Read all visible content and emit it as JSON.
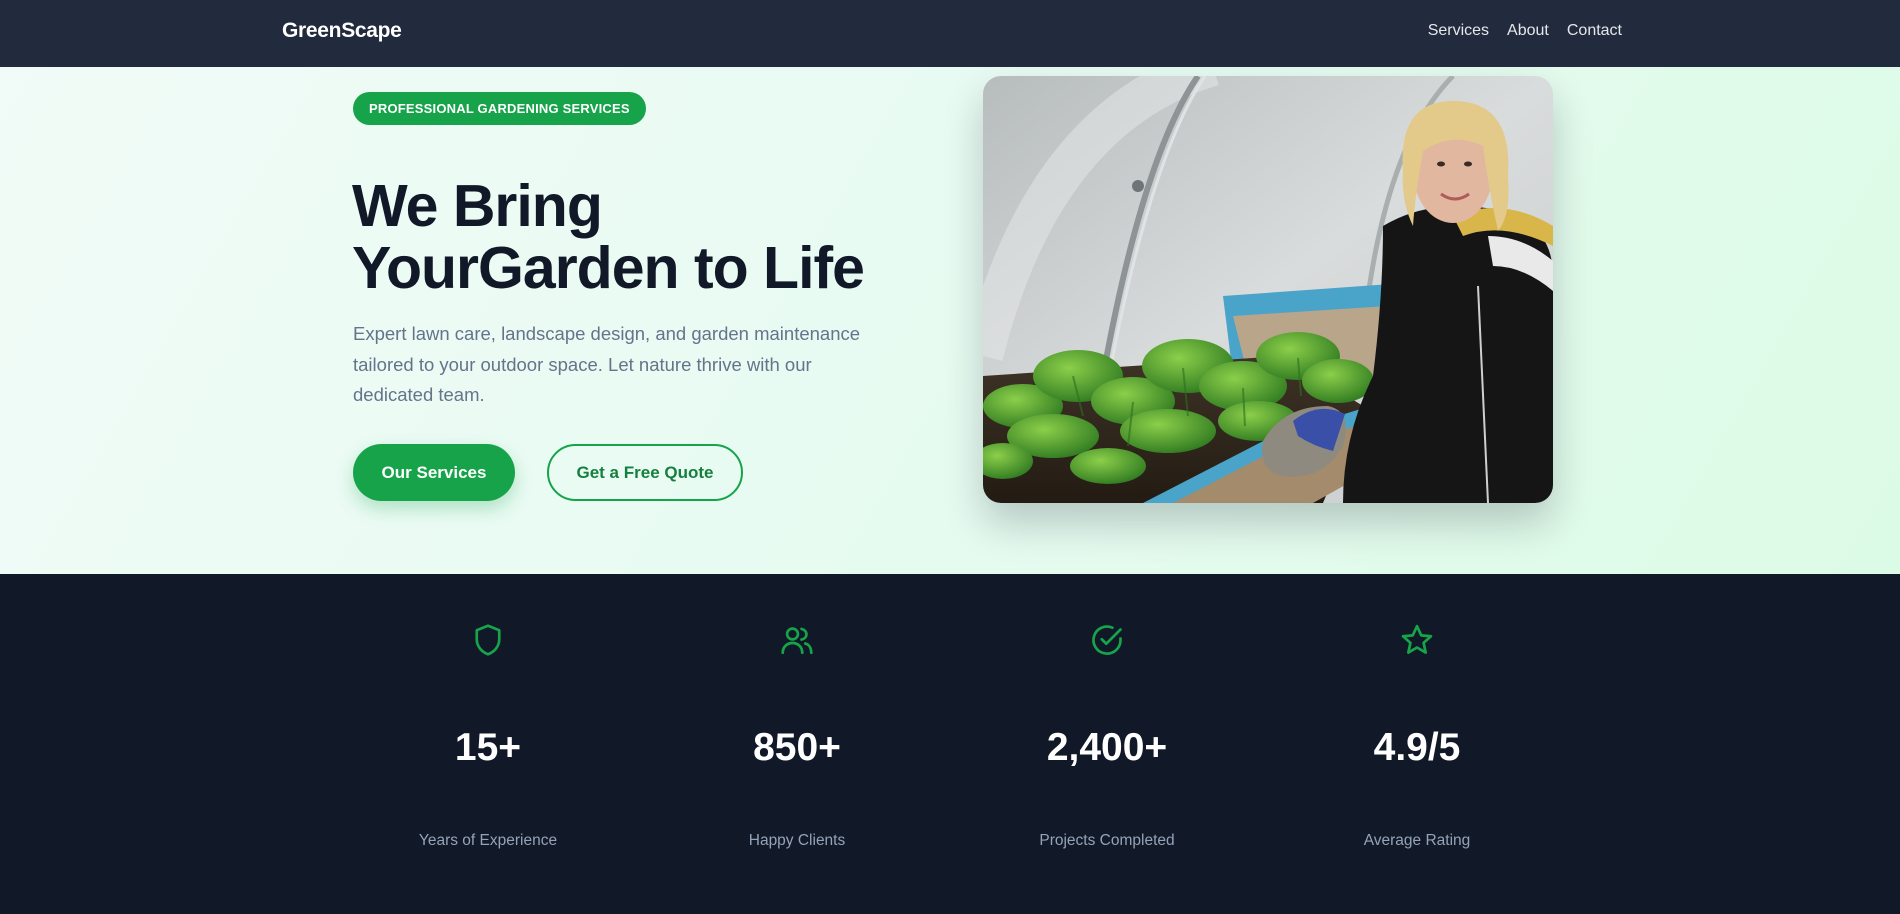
{
  "nav": {
    "logo": "GreenScape",
    "links": [
      "Services",
      "About",
      "Contact"
    ]
  },
  "hero": {
    "badge": "PROFESSIONAL GARDENING SERVICES",
    "headline_line1": "We Bring",
    "headline_line2": "YourGarden to Life",
    "lede": "Expert lawn care, landscape design, and garden maintenance tailored to your outdoor space. Let nature thrive with our dedicated team.",
    "primary_button": "Our Services",
    "secondary_button": "Get a Free Quote",
    "image_icon": "gardener-photo"
  },
  "stats": [
    {
      "icon": "shield-icon",
      "value": "15+",
      "label": "Years of Experience"
    },
    {
      "icon": "users-icon",
      "value": "850+",
      "label": "Happy Clients"
    },
    {
      "icon": "check-circle-icon",
      "value": "2,400+",
      "label": "Projects Completed"
    },
    {
      "icon": "star-icon",
      "value": "4.9/5",
      "label": "Average Rating"
    }
  ],
  "colors": {
    "accent": "#16a34a",
    "nav_bg": "#222a3d",
    "stats_bg": "#111827",
    "heading": "#111827",
    "muted": "#64748b"
  }
}
